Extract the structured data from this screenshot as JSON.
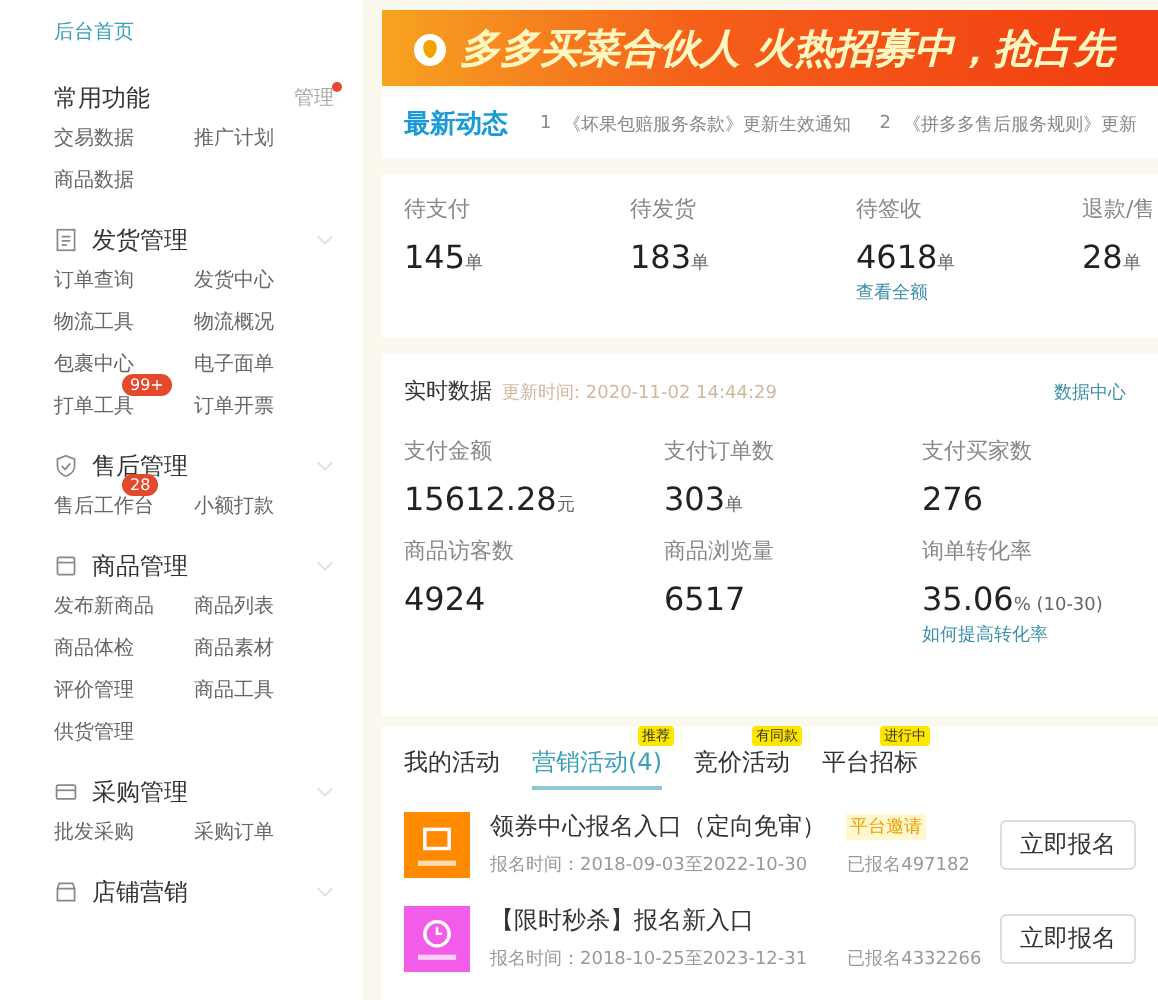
{
  "sidebar": {
    "home_link": "后台首页",
    "favorites": {
      "title": "常用功能",
      "manage": "管理",
      "manage_dot": true,
      "items": [
        {
          "label": "交易数据"
        },
        {
          "label": "推广计划"
        },
        {
          "label": "商品数据"
        }
      ]
    },
    "sections": [
      {
        "kind": "doc",
        "title": "发货管理",
        "items": [
          {
            "label": "订单查询"
          },
          {
            "label": "发货中心"
          },
          {
            "label": "物流工具"
          },
          {
            "label": "物流概况"
          },
          {
            "label": "包裹中心"
          },
          {
            "label": "电子面单"
          },
          {
            "label": "打单工具",
            "badge": "99+"
          },
          {
            "label": "订单开票"
          }
        ]
      },
      {
        "kind": "check",
        "title": "售后管理",
        "items": [
          {
            "label": "售后工作台",
            "badge": "28"
          },
          {
            "label": "小额打款"
          }
        ]
      },
      {
        "kind": "box",
        "title": "商品管理",
        "items": [
          {
            "label": "发布新商品"
          },
          {
            "label": "商品列表"
          },
          {
            "label": "商品体检"
          },
          {
            "label": "商品素材"
          },
          {
            "label": "评价管理"
          },
          {
            "label": "商品工具"
          },
          {
            "label": "供货管理"
          }
        ]
      },
      {
        "kind": "cart",
        "title": "采购管理",
        "items": [
          {
            "label": "批发采购"
          },
          {
            "label": "采购订单"
          }
        ]
      },
      {
        "kind": "shop",
        "title": "店铺营销"
      }
    ]
  },
  "banner": {
    "text": "多多买菜合伙人 火热招募中，抢占先"
  },
  "news": {
    "title": "最新动态",
    "items": [
      {
        "index": "1",
        "text": "《坏果包赔服务条款》更新生效通知"
      },
      {
        "index": "2",
        "text": "《拼多多售后服务规则》更新"
      }
    ]
  },
  "order_stats": [
    {
      "label": "待支付",
      "value": "145",
      "unit": "单"
    },
    {
      "label": "待发货",
      "value": "183",
      "unit": "单"
    },
    {
      "label": "待签收",
      "value": "4618",
      "unit": "单",
      "link": "查看全额"
    },
    {
      "label": "退款/售",
      "value": "28",
      "unit": "单"
    }
  ],
  "realtime": {
    "title": "实时数据",
    "updated": "更新时间: 2020-11-02 14:44:29",
    "link": "数据中心",
    "metrics": [
      {
        "label": "支付金额",
        "value": "15612.28",
        "unit": "元"
      },
      {
        "label": "支付订单数",
        "value": "303",
        "unit": "单"
      },
      {
        "label": "支付买家数",
        "value": "276"
      },
      {
        "label": "商品访客数",
        "value": "4924"
      },
      {
        "label": "商品浏览量",
        "value": "6517"
      },
      {
        "label": "询单转化率",
        "value": "35.06",
        "unit": "% (10-30)",
        "link": "如何提高转化率"
      }
    ]
  },
  "activity_tabs": [
    {
      "label": "我的活动",
      "selected": false
    },
    {
      "label": "营销活动(4)",
      "selected": true,
      "badge": "推荐"
    },
    {
      "label": "竞价活动",
      "selected": false,
      "badge": "有同款"
    },
    {
      "label": "平台招标",
      "selected": false,
      "badge": "进行中"
    }
  ],
  "activities": [
    {
      "kind": "coupon",
      "color": "#ff8a00",
      "title": "领券中心报名入口（定向免审）",
      "tag": "平台邀请",
      "period": "报名时间：2018-09-03至2022-10-30",
      "signed": "已报名497182",
      "button": "立即报名"
    },
    {
      "kind": "clock",
      "color": "#f25ce8",
      "title": "【限时秒杀】报名新入口",
      "period": "报名时间：2018-10-25至2023-12-31",
      "signed": "已报名4332266",
      "button": "立即报名"
    }
  ]
}
